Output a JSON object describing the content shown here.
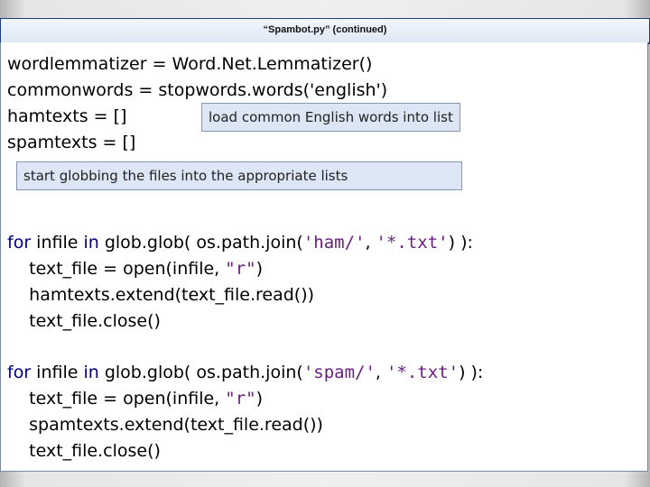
{
  "title": "“Spambot.py” (continued)",
  "code": {
    "line1": "wordlemmatizer = Word.Net.Lemmatizer()",
    "line2": "commonwords = stopwords.words('english')",
    "line3": "hamtexts = []",
    "line4": "spamtexts = []"
  },
  "callouts": {
    "common_words": "load common English words into list",
    "globbing": "start globbing the files into the appropriate lists"
  },
  "ham_block": {
    "kw_for": "for",
    "seg1": " infile ",
    "kw_in": "in",
    "seg2": " glob.glob( os.path.join(",
    "arg1": "'ham/'",
    "comma": ", ",
    "arg2": "'*.txt'",
    "seg3": ") ):",
    "line2_a": "    text_file = open(infile, ",
    "line2_str": "\"r\"",
    "line2_b": ")",
    "line3": "    hamtexts.extend(text_file.read())",
    "line4": "    text_file.close()"
  },
  "spam_block": {
    "kw_for": "for",
    "seg1": " infile ",
    "kw_in": "in",
    "seg2": " glob.glob( os.path.join(",
    "arg1": "'spam/'",
    "comma": ", ",
    "arg2": "'*.txt'",
    "seg3": ") ):",
    "line2_a": "    text_file = open(infile, ",
    "line2_str": "\"r\"",
    "line2_b": ")",
    "line3": "    spamtexts.extend(text_file.read())",
    "line4": "    text_file.close()"
  }
}
